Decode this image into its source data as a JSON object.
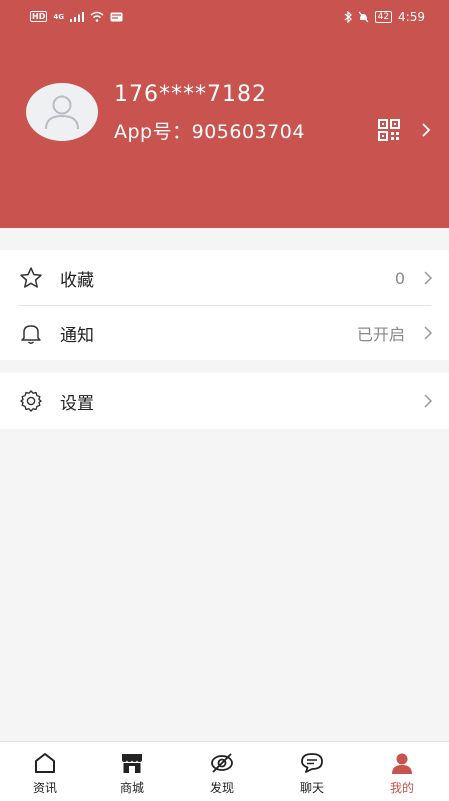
{
  "status_bar": {
    "left_badges": [
      "HD",
      "4G"
    ],
    "battery": "42",
    "time": "4:59"
  },
  "profile": {
    "phone": "176****7182",
    "app_id_label": "App号：",
    "app_id": "905603704"
  },
  "menu": [
    {
      "label": "收藏",
      "value": "0",
      "icon": "star-icon"
    },
    {
      "label": "通知",
      "value": "已开启",
      "icon": "bell-icon"
    },
    {
      "label": "设置",
      "value": "",
      "icon": "gear-icon"
    }
  ],
  "tabs": [
    {
      "label": "资讯",
      "icon": "home-icon"
    },
    {
      "label": "商城",
      "icon": "store-icon"
    },
    {
      "label": "发现",
      "icon": "discover-icon"
    },
    {
      "label": "聊天",
      "icon": "chat-icon"
    },
    {
      "label": "我的",
      "icon": "person-icon",
      "active": true
    }
  ],
  "colors": {
    "accent": "#c9534f",
    "background": "#f5f5f5"
  }
}
